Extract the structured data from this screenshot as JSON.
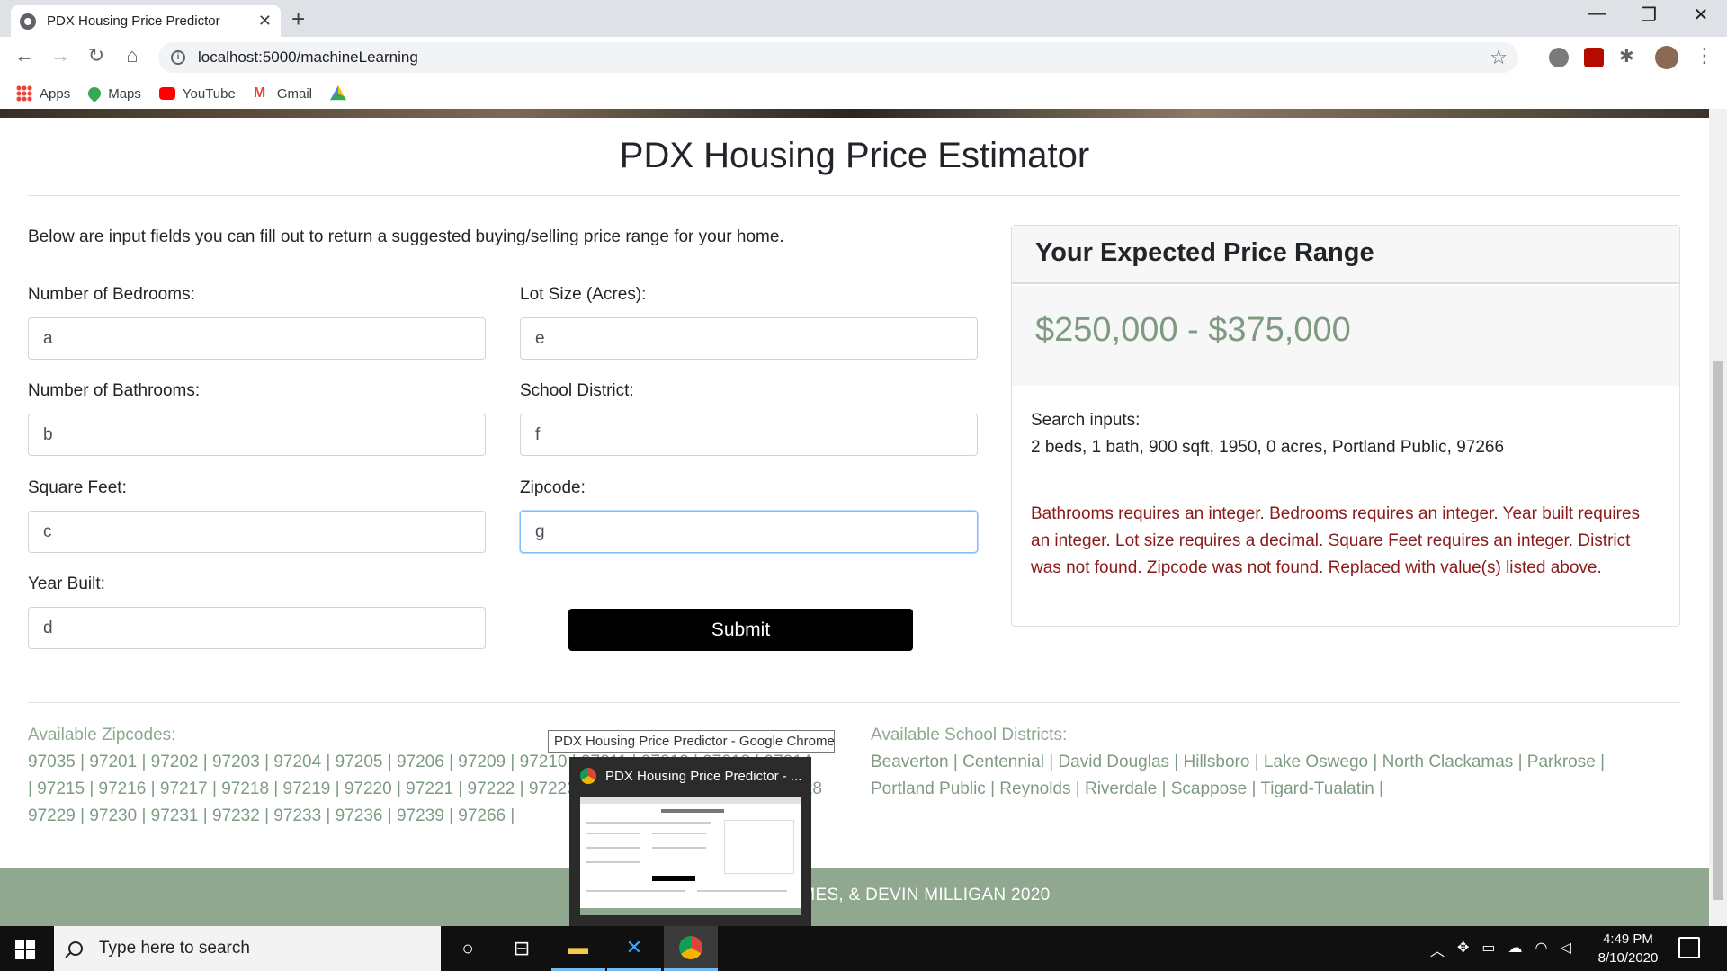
{
  "browser": {
    "tab_title": "PDX Housing Price Predictor",
    "tab_close": "✕",
    "new_tab": "+",
    "url": "localhost:5000/machineLearning",
    "bookmarks": [
      "Apps",
      "Maps",
      "YouTube",
      "Gmail"
    ]
  },
  "page": {
    "title": "PDX Housing Price Estimator",
    "intro": "Below are input fields you can fill out to return a suggested buying/selling price range for your home.",
    "fields": {
      "bedrooms": {
        "label": "Number of Bedrooms:",
        "value": "a"
      },
      "bathrooms": {
        "label": "Number of Bathrooms:",
        "value": "b"
      },
      "sqft": {
        "label": "Square Feet:",
        "value": "c"
      },
      "year": {
        "label": "Year Built:",
        "value": "d"
      },
      "lot": {
        "label": "Lot Size (Acres):",
        "value": "e"
      },
      "district": {
        "label": "School District:",
        "value": "f"
      },
      "zipcode": {
        "label": "Zipcode:",
        "value": "g"
      }
    },
    "submit_label": "Submit",
    "result": {
      "title": "Your Expected Price Range",
      "price": "$250,000 - $375,000",
      "search_label": "Search inputs:",
      "search_values": "2 beds, 1 bath, 900 sqft, 1950, 0 acres, Portland Public, 97266",
      "errors": "Bathrooms requires an integer. Bedrooms requires an integer. Year built requires an integer. Lot size requires a decimal. Square Feet requires an integer. District was not found. Zipcode was not found. Replaced with value(s) listed above."
    },
    "zipcodes": {
      "title": "Available Zipcodes:",
      "line1": "97035 | 97201 | 97202 | 97203 | 97204 | 97205 | 97206 | 97209 | 97210 | 97211 | 97212 | 97213 | 97214",
      "line2": "| 97215 | 97216 | 97217 | 97218 | 97219 | 97220 | 97221 | 97222 | 97223 | 97224 | 97225 | 97227 | 97228",
      "line3": "97229 | 97230 | 97231 | 97232 | 97233 | 97236 | 97239 | 97266 |"
    },
    "districts": {
      "title": "Available School Districts:",
      "line1": "Beaverton | Centennial | David Douglas | Hillsboro | Lake Oswego | North Clackamas | Parkrose |",
      "line2": "Portland Public | Reynolds | Riverdale | Scappose | Tigard-Tualatin |"
    },
    "footer": "© ... RISTAN HOLMES, & DEVIN MILLIGAN 2020"
  },
  "overlay": {
    "tooltip": "PDX Housing Price Predictor - Google Chrome",
    "preview_title": "PDX Housing Price Predictor - ..."
  },
  "taskbar": {
    "search_placeholder": "Type here to search",
    "time": "4:49 PM",
    "date": "8/10/2020"
  },
  "colors": {
    "accent_green": "#8fa88f",
    "price_green": "#7e9b82",
    "error_red": "#8b1a1a"
  }
}
